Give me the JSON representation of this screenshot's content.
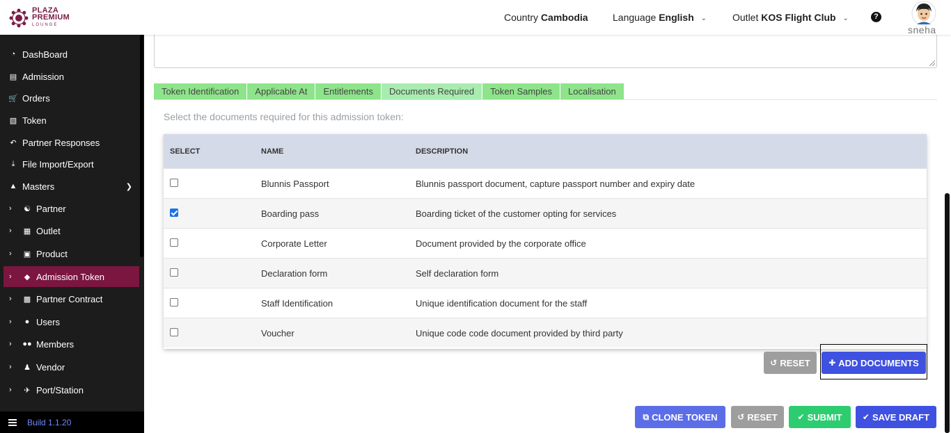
{
  "brand": {
    "line1": "PLAZA",
    "line2": "PREMIUM",
    "line3": "LOUNGE"
  },
  "header": {
    "country_label": "Country",
    "country_value": "Cambodia",
    "language_label": "Language",
    "language_value": "English",
    "outlet_label": "Outlet",
    "outlet_value": "KOS Flight Club",
    "help_glyph": "?",
    "user_name": "sneha"
  },
  "sidebar": {
    "items": [
      {
        "label": "DashBoard",
        "icon": "dashboard-icon"
      },
      {
        "label": "Admission",
        "icon": "id-card-icon"
      },
      {
        "label": "Orders",
        "icon": "cart-icon"
      },
      {
        "label": "Token",
        "icon": "file-icon"
      },
      {
        "label": "Partner Responses",
        "icon": "reply-icon"
      },
      {
        "label": "File Import/Export",
        "icon": "download-icon"
      },
      {
        "label": "Masters",
        "icon": "sitemap-icon"
      },
      {
        "label": "Partner",
        "icon": "handshake-icon"
      },
      {
        "label": "Outlet",
        "icon": "building-icon"
      },
      {
        "label": "Product",
        "icon": "gift-icon"
      },
      {
        "label": "Admission Token",
        "icon": "tag-icon"
      },
      {
        "label": "Partner Contract",
        "icon": "briefcase-icon"
      },
      {
        "label": "Users",
        "icon": "user-icon"
      },
      {
        "label": "Members",
        "icon": "users-icon"
      },
      {
        "label": "Vendor",
        "icon": "person-icon"
      },
      {
        "label": "Port/Station",
        "icon": "plane-icon"
      }
    ],
    "build": "Build 1.1.20"
  },
  "tabs": [
    "Token Identification",
    "Applicable At",
    "Entitlements",
    "Documents Required",
    "Token Samples",
    "Localisation"
  ],
  "active_tab": "Documents Required",
  "instruction": "Select the documents required for this admission token:",
  "table": {
    "headers": [
      "SELECT",
      "NAME",
      "DESCRIPTION"
    ],
    "rows": [
      {
        "name": "Blunnis Passport",
        "description": "Blunnis passport document, capture passport number and expiry date",
        "checked": false
      },
      {
        "name": "Boarding pass",
        "description": "Boarding ticket of the customer opting for services",
        "checked": true
      },
      {
        "name": "Corporate Letter",
        "description": "Document provided by the corporate office",
        "checked": false
      },
      {
        "name": "Declaration form",
        "description": "Self declaration form",
        "checked": false
      },
      {
        "name": "Staff Identification",
        "description": "Unique identification document for the staff",
        "checked": false
      },
      {
        "name": "Voucher",
        "description": "Unique code code document provided by third party",
        "checked": false
      }
    ]
  },
  "buttons": {
    "reset_table": "RESET",
    "add_documents": "ADD DOCUMENTS",
    "clone_token": "CLONE TOKEN",
    "reset": "RESET",
    "submit": "SUBMIT",
    "save_draft": "SAVE DRAFT"
  },
  "colors": {
    "brand": "#7a1c44",
    "active_nav": "#7a1640",
    "tab": "#8ee48a",
    "primary": "#3f51e0",
    "success": "#2ecc71"
  }
}
